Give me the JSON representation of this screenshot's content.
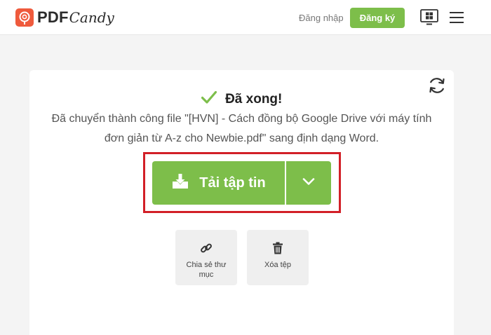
{
  "header": {
    "logo_pdf": "PDF",
    "logo_candy": "Candy",
    "login_label": "Đăng nhập",
    "signup_label": "Đăng ký",
    "icons": [
      "logo-candy-icon",
      "windows-icon",
      "hamburger-menu-icon"
    ]
  },
  "result": {
    "title": "Đã xong!",
    "message": "Đã chuyển thành công file \"[HVN] - Cách đồng bộ Google Drive với máy tính đơn giản từ A-z cho Newbie.pdf\" sang định dạng Word.",
    "icons": [
      "check-icon",
      "refresh-icon"
    ]
  },
  "download": {
    "label": "Tải tập tin",
    "icons": [
      "download-icon",
      "chevron-down-icon"
    ]
  },
  "actions": {
    "share_label": "Chia sẻ thư mục",
    "delete_label": "Xóa tệp",
    "icons": [
      "link-icon",
      "trash-icon"
    ]
  },
  "colors": {
    "accent_green": "#7dbe4a",
    "brand_orange": "#ef5a3c",
    "highlight_red": "#d21f27"
  }
}
